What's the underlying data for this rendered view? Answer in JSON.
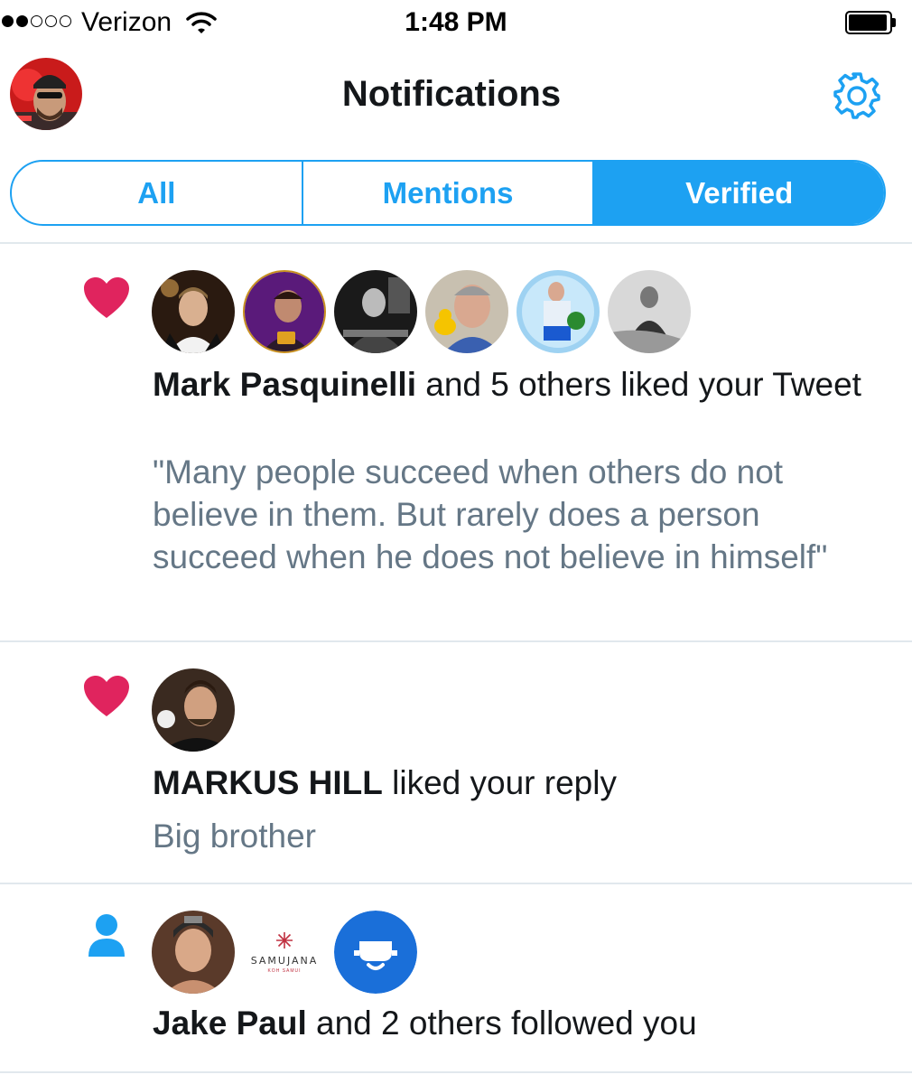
{
  "status_bar": {
    "carrier": "Verizon",
    "time": "1:48 PM",
    "signal_bars_filled": 2,
    "signal_bars_total": 5,
    "battery_level": 0.85
  },
  "header": {
    "title": "Notifications",
    "settings_icon": "gear-icon",
    "profile_avatar": "avatar"
  },
  "tabs": [
    {
      "label": "All",
      "active": false
    },
    {
      "label": "Mentions",
      "active": false
    },
    {
      "label": "Verified",
      "active": true
    }
  ],
  "notifications": [
    {
      "type": "like",
      "icon": "heart-icon",
      "actor": "Mark Pasquinelli",
      "action": " and 5 others liked your Tweet",
      "content": "\"Many people succeed when others do not believe in them. But rarely does a person succeed when he does not believe in himself\"",
      "avatar_count": 6
    },
    {
      "type": "like",
      "icon": "heart-icon",
      "actor": "MARKUS HILL",
      "action": " liked your reply",
      "content": "Big brother",
      "avatar_count": 1
    },
    {
      "type": "follow",
      "icon": "person-icon",
      "actor": "Jake Paul",
      "action": " and 2 others followed you",
      "content": "",
      "avatar_count": 3,
      "logo_text": "SAMUJANA",
      "logo_subtext": "KOH SAMUI"
    }
  ],
  "colors": {
    "accent": "#1da1f2",
    "like": "#e0245e",
    "secondary_text": "#657786",
    "divider": "#e1e8ed"
  }
}
